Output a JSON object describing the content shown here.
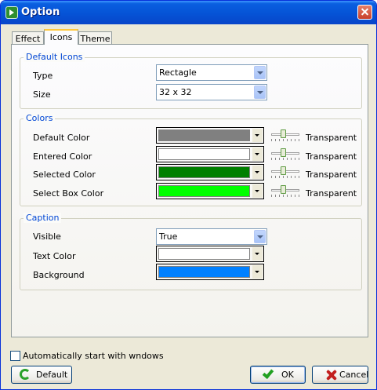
{
  "window": {
    "title": "Option"
  },
  "tabs": [
    {
      "label": "Effect"
    },
    {
      "label": "Icons"
    },
    {
      "label": "Theme"
    }
  ],
  "default_icons": {
    "title": "Default Icons",
    "type_label": "Type",
    "type_value": "Rectagle",
    "size_label": "Size",
    "size_value": "32 x 32"
  },
  "colors": {
    "title": "Colors",
    "transparent_label": "Transparent",
    "rows": [
      {
        "label": "Default Color",
        "color": "#808080"
      },
      {
        "label": "Entered Color",
        "color": "#ffffff"
      },
      {
        "label": "Selected Color",
        "color": "#008000"
      },
      {
        "label": "Select Box Color",
        "color": "#00ff00"
      }
    ]
  },
  "caption": {
    "title": "Caption",
    "visible_label": "Visible",
    "visible_value": "True",
    "text_color_label": "Text Color",
    "text_color": "#ffffff",
    "background_label": "Background",
    "background_color": "#0080ff"
  },
  "footer": {
    "autostart_label": "Automatically start with wndows",
    "autostart_checked": false,
    "default_button": "Default",
    "ok_button": "OK",
    "cancel_button": "Cancel"
  }
}
